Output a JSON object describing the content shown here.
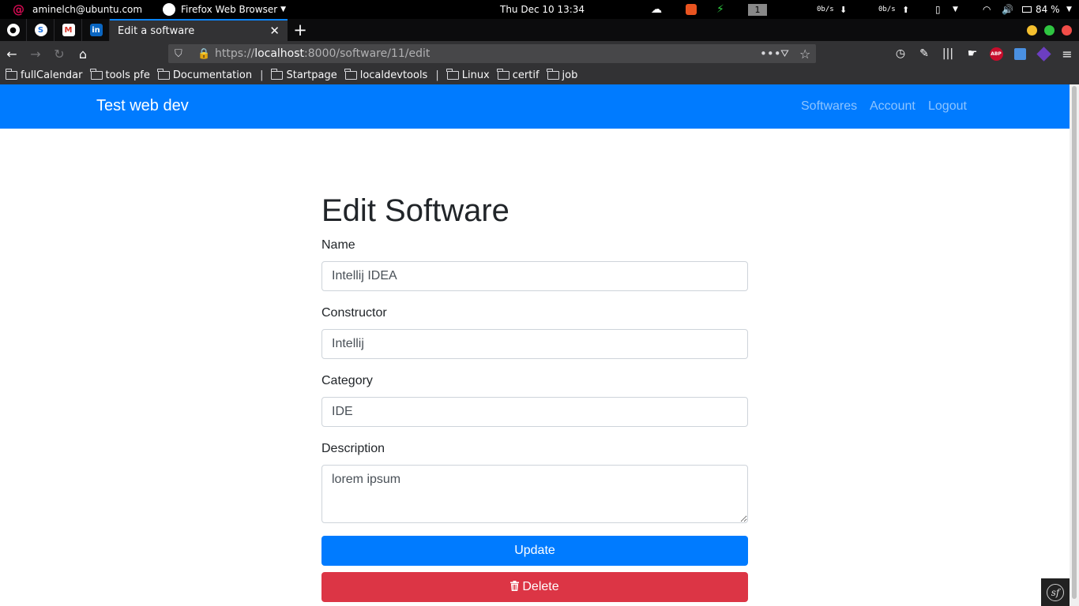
{
  "os": {
    "user": "aminelch@ubuntu.com",
    "app": "Firefox Web Browser",
    "clock": "Thu Dec 10  13:34",
    "workspace": "1",
    "net_down": "0b/s",
    "net_up": "0b/s",
    "battery": "84 %"
  },
  "browser": {
    "tab_title": "Edit a software",
    "url_scheme": "https://",
    "url_host": "localhost",
    "url_path": ":8000/software/11/edit",
    "abp": "ABP"
  },
  "bookmarks": [
    "fullCalendar",
    "tools pfe",
    "Documentation",
    "Startpage",
    "localdevtools",
    "Linux",
    "certif",
    "job"
  ],
  "site": {
    "brand": "Test web dev",
    "nav": [
      "Softwares",
      "Account",
      "Logout"
    ]
  },
  "form": {
    "heading": "Edit Software",
    "name_label": "Name",
    "name_value": "Intellij IDEA",
    "constructor_label": "Constructor",
    "constructor_value": "Intellij",
    "category_label": "Category",
    "category_value": "IDE",
    "description_label": "Description",
    "description_value": "lorem ipsum",
    "update_label": "Update",
    "delete_label": "Delete"
  },
  "icons": {
    "trash": "trash-icon",
    "github": "github-icon",
    "gmail": "gmail-icon",
    "linkedin": "linkedin-icon"
  },
  "colors": {
    "primary": "#007bff",
    "danger": "#dc3545",
    "tab_accent": "#0a84ff"
  }
}
